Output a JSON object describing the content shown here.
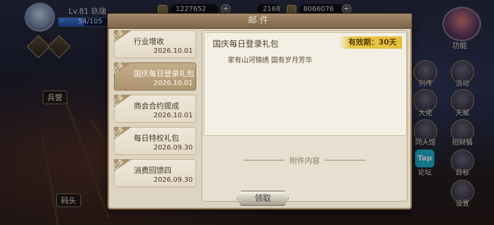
{
  "player": {
    "level_name": "Lv.81  玖瑞",
    "stamina": "54/105",
    "stamina_fraction": 0.51
  },
  "currencies": [
    {
      "value": "1227652"
    },
    {
      "value": "2168"
    },
    {
      "value": "8066076"
    }
  ],
  "hud": {
    "feature_label": "功能",
    "left_label_1": "兵营",
    "left_label_2": "码头",
    "right_menu": [
      {
        "label": "列传"
      },
      {
        "label": "活动"
      },
      {
        "label": "大佬"
      },
      {
        "label": "天赋"
      },
      {
        "label": "同人馆"
      },
      {
        "label": "招财猫"
      },
      {
        "label": "论坛"
      },
      {
        "label": "目标"
      },
      {
        "label": "设置"
      }
    ],
    "tap_text": "Tap"
  },
  "mail": {
    "title": "邮件",
    "read_tag": "已读",
    "items": [
      {
        "title": "行业增收",
        "date": "2026.10.01"
      },
      {
        "title": "国庆每日登录礼包",
        "date": "2026.10.01"
      },
      {
        "title": "商会合约提成",
        "date": "2026.10.01"
      },
      {
        "title": "每日特权礼包",
        "date": "2026.09.30"
      },
      {
        "title": "消费回馈四",
        "date": "2026.09.30"
      }
    ],
    "selected_index": 1,
    "detail": {
      "title": "国庆每日登录礼包",
      "validity": "有效期：30天",
      "content": "家有山河锦绣  国有岁月芳华",
      "attachment_label": "附件内容"
    },
    "claim_button": "领取"
  },
  "colors": {
    "accent_gold": "#e3bf3a",
    "frame_brown": "#9c8766",
    "panel_cream": "#ddd4c2"
  }
}
